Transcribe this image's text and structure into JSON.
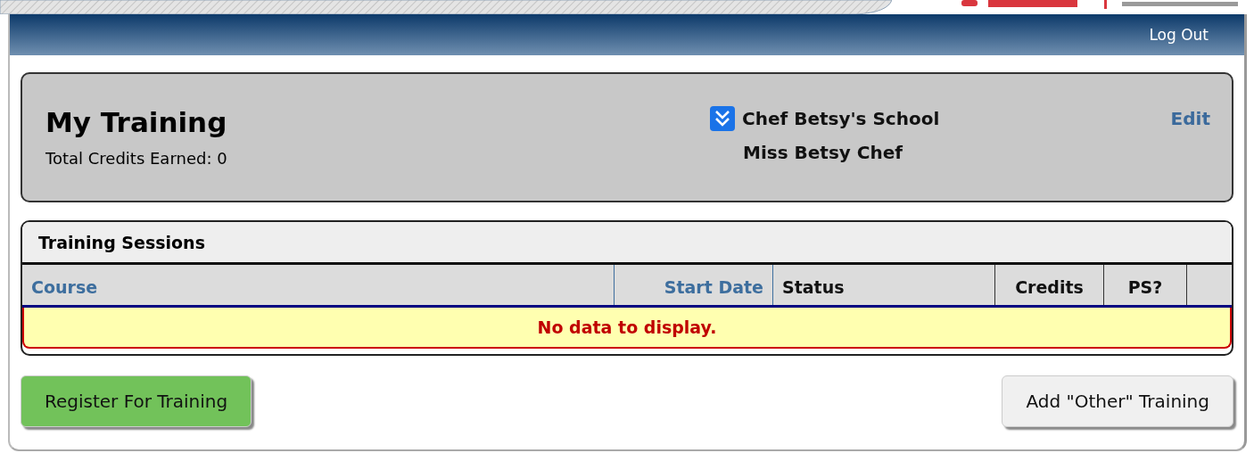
{
  "header": {
    "logout": "Log Out"
  },
  "profile": {
    "title": "My Training",
    "credits": "Total Credits Earned: 0",
    "school": "Chef Betsy's School",
    "name": "Miss Betsy Chef",
    "edit": "Edit"
  },
  "sessions": {
    "title": "Training Sessions",
    "columns": [
      {
        "label": "Course",
        "sortable": true
      },
      {
        "label": "Start Date",
        "sortable": true
      },
      {
        "label": "Status",
        "sortable": false
      },
      {
        "label": "Credits",
        "sortable": false
      },
      {
        "label": "PS?",
        "sortable": false
      }
    ],
    "empty_message": "No data to display."
  },
  "buttons": [
    {
      "label": "Register For Training",
      "kind": "primary"
    },
    {
      "label": "Add \"Other\" Training",
      "kind": "secondary"
    }
  ]
}
